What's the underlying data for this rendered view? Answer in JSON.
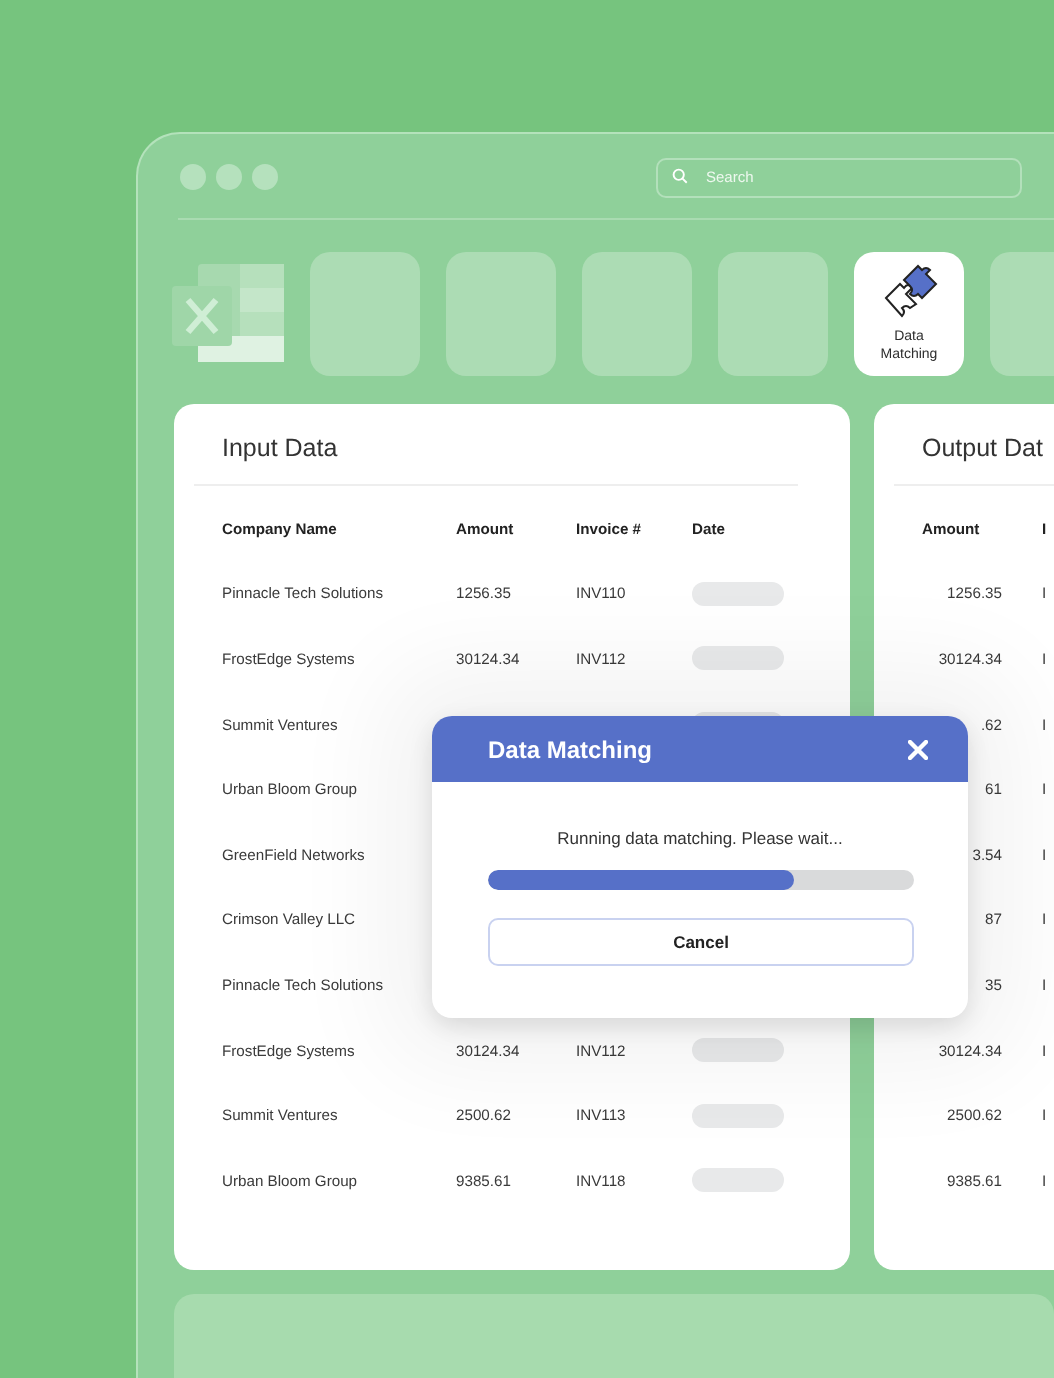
{
  "search": {
    "placeholder": "Search"
  },
  "toolbar": {
    "tiles": [
      {
        "selected": false
      },
      {
        "selected": false
      },
      {
        "selected": false
      },
      {
        "selected": false
      },
      {
        "label": "Data Matching",
        "selected": true
      },
      {
        "selected": false
      }
    ]
  },
  "input_card": {
    "title": "Input Data",
    "columns": [
      "Company Name",
      "Amount",
      "Invoice #",
      "Date"
    ],
    "rows": [
      {
        "company": "Pinnacle Tech Solutions",
        "amount": "1256.35",
        "invoice": "INV110",
        "date_placeholder": true
      },
      {
        "company": "FrostEdge Systems",
        "amount": "30124.34",
        "invoice": "INV112",
        "date_placeholder": true
      },
      {
        "company": "Summit Ventures",
        "date_placeholder": true
      },
      {
        "company": "Urban Bloom Group"
      },
      {
        "company": "GreenField Networks"
      },
      {
        "company": "Crimson Valley LLC"
      },
      {
        "company": "Pinnacle Tech Solutions"
      },
      {
        "company": "FrostEdge Systems",
        "amount": "30124.34",
        "invoice": "INV112",
        "date_placeholder": true
      },
      {
        "company": "Summit Ventures",
        "amount": "2500.62",
        "invoice": "INV113",
        "date_placeholder": true
      },
      {
        "company": "Urban Bloom Group",
        "amount": "9385.61",
        "invoice": "INV118",
        "date_placeholder": true
      }
    ]
  },
  "output_card": {
    "title": "Output Dat",
    "columns": [
      "Amount",
      "I"
    ],
    "rows": [
      {
        "amount": "1256.35",
        "invoice": "I"
      },
      {
        "amount": "30124.34",
        "invoice": "I"
      },
      {
        "amount": ".62",
        "invoice": "I"
      },
      {
        "amount": "61",
        "invoice": "I"
      },
      {
        "amount": "3.54",
        "invoice": "I"
      },
      {
        "amount": "87",
        "invoice": "I"
      },
      {
        "amount": "35",
        "invoice": "I"
      },
      {
        "amount": "30124.34",
        "invoice": "I"
      },
      {
        "amount": "2500.62",
        "invoice": "I"
      },
      {
        "amount": "9385.61",
        "invoice": "I"
      }
    ]
  },
  "dialog": {
    "title": "Data Matching",
    "message": "Running data matching. Please wait...",
    "level": 0.72,
    "cancel": "Cancel"
  }
}
